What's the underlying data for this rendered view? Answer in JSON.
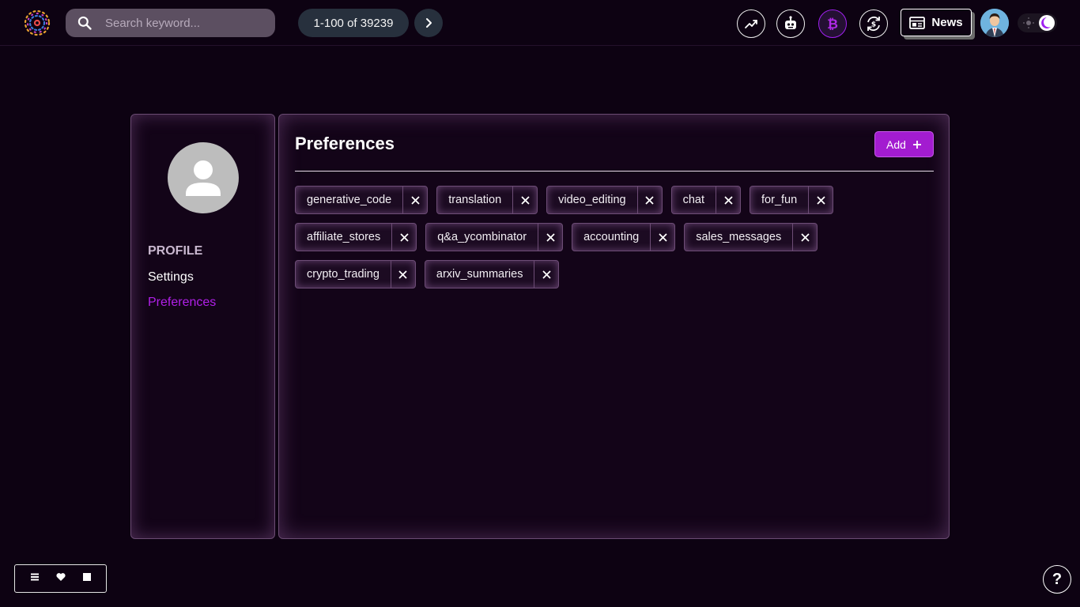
{
  "header": {
    "search_placeholder": "Search keyword...",
    "pager_text": "1-100 of 39239",
    "news_label": "News",
    "icons": [
      "trending-icon",
      "robot-icon",
      "bitcoin-icon",
      "currency-exchange-icon"
    ]
  },
  "sidebar": {
    "items": [
      {
        "label": "PROFILE"
      },
      {
        "label": "Settings"
      },
      {
        "label": "Preferences"
      }
    ]
  },
  "panel": {
    "title": "Preferences",
    "add_label": "Add",
    "tags": [
      [
        "generative_code",
        "translation",
        "video_editing",
        "chat",
        "for_fun"
      ],
      [
        "affiliate_stores",
        "q&a_ycombinator",
        "accounting",
        "sales_messages"
      ],
      [
        "crypto_trading",
        "arxiv_summaries"
      ]
    ]
  },
  "colors": {
    "accent": "#a31cd0",
    "background": "#0d0212",
    "active_nav": "#b020e8"
  }
}
